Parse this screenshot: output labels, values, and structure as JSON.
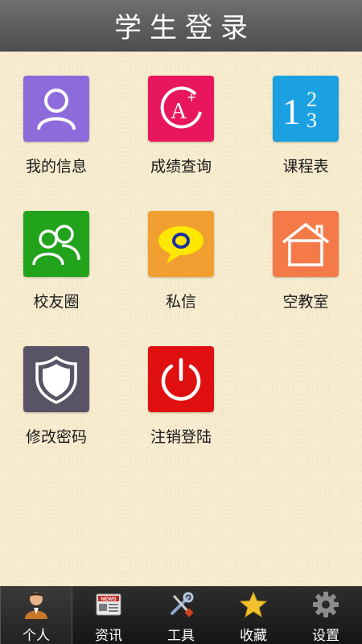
{
  "header": {
    "title": "学生登录"
  },
  "tiles": [
    {
      "label": "我的信息",
      "color": "#8e6bdb",
      "icon": "user-icon"
    },
    {
      "label": "成绩查询",
      "color": "#e8175d",
      "icon": "grade-a-plus-icon"
    },
    {
      "label": "课程表",
      "color": "#1ba1e2",
      "icon": "numbers-123-icon"
    },
    {
      "label": "校友圈",
      "color": "#21a31b",
      "icon": "group-icon"
    },
    {
      "label": "私信",
      "color": "#f0a030",
      "icon": "message-bubble-icon"
    },
    {
      "label": "空教室",
      "color": "#f57a4a",
      "icon": "house-icon"
    },
    {
      "label": "修改密码",
      "color": "#585466",
      "icon": "shield-icon"
    },
    {
      "label": "注销登陆",
      "color": "#e01010",
      "icon": "power-icon"
    }
  ],
  "tabs": [
    {
      "label": "个人",
      "icon": "person-icon",
      "active": true
    },
    {
      "label": "资讯",
      "icon": "news-icon",
      "active": false
    },
    {
      "label": "工具",
      "icon": "tools-icon",
      "active": false
    },
    {
      "label": "收藏",
      "icon": "star-icon",
      "active": false
    },
    {
      "label": "设置",
      "icon": "gear-icon",
      "active": false
    }
  ],
  "icon_texts": {
    "grade": "A",
    "grade_plus": "+",
    "num1": "1",
    "num2": "2",
    "num3": "3",
    "news": "NEWS"
  }
}
